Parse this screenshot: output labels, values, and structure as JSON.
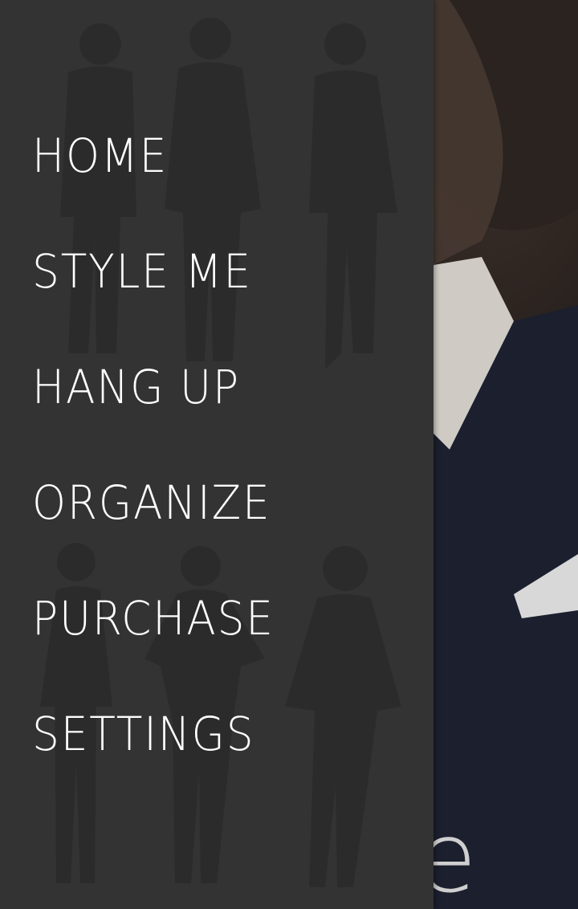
{
  "background": {
    "partial_title": "e"
  },
  "drawer": {
    "items": [
      {
        "label": "HOME"
      },
      {
        "label": "STYLE ME"
      },
      {
        "label": "HANG UP"
      },
      {
        "label": "ORGANIZE"
      },
      {
        "label": "PURCHASE"
      },
      {
        "label": "SETTINGS"
      }
    ]
  },
  "colors": {
    "drawer_background": "#333333",
    "menu_text": "#ffffff",
    "figure_silhouette": "#1f1f1f"
  }
}
